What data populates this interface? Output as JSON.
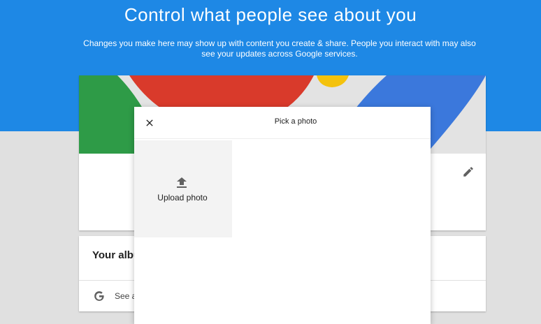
{
  "header": {
    "title": "Control what people see about you",
    "subtitle": "Changes you make here may show up with content you create & share. People you interact with may also see your updates across Google services."
  },
  "profile_card": {
    "edit_icon": "pencil-icon"
  },
  "albums_card": {
    "title": "Your albu",
    "link_text": "See a",
    "icon": "google-g-icon"
  },
  "dialog": {
    "title": "Pick a photo",
    "close_icon": "close-icon",
    "upload_label": "Upload photo",
    "upload_icon": "upload-icon"
  },
  "colors": {
    "header_blue": "#1e88e5",
    "green": "#2e9b47",
    "red": "#d93a2b",
    "yellow": "#f4c20d",
    "blue": "#3b78dc"
  }
}
